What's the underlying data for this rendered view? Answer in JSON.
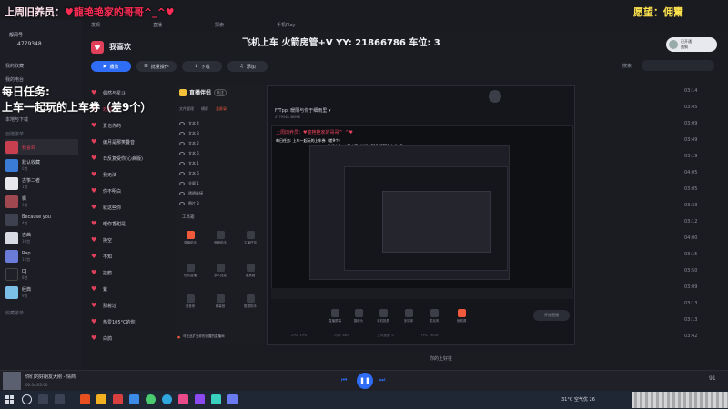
{
  "overlay": {
    "top_left_prefix": "上周旧养员：",
    "top_left_name": "♥龍艳艳家的哥哥^_^♥",
    "top_right": "愿望：佣鬻",
    "center_banner": "飞机上车 火箭房管+V YY: 21866786 车位: 3",
    "task_line1": "每日任务:",
    "task_line2": "上车一起玩的上车券（差9个）",
    "badge_id": "4779348",
    "badge_label": "靓阅号"
  },
  "music_app": {
    "nav": [
      "发现",
      "直播",
      "探索",
      "手机Play"
    ],
    "sidebar": {
      "items": [
        "我的收藏",
        "我的电台",
        "本地与下载"
      ],
      "section_created": "创建歌单",
      "section_collected": "收藏歌单",
      "playlists": [
        {
          "name": "我喜欢",
          "sub": "",
          "color": "#c84050"
        },
        {
          "name": "默认收藏",
          "sub": "0首",
          "color": "#3b7bd8"
        },
        {
          "name": "古筝二者",
          "sub": "1首",
          "color": "#e8e8ec"
        },
        {
          "name": "枫",
          "sub": "3首",
          "color": "#a0484f"
        },
        {
          "name": "Because you",
          "sub": "4首",
          "color": "#3e4150"
        },
        {
          "name": "古曲",
          "sub": "10首",
          "color": "#d8dbe4"
        },
        {
          "name": "Rap",
          "sub": "12首",
          "color": "#6a7bd8"
        },
        {
          "name": "DJ",
          "sub": "8首",
          "color": "#202028"
        },
        {
          "name": "经典",
          "sub": "9首",
          "color": "#7cc0e8"
        }
      ]
    },
    "library_title": "我喜欢",
    "buttons": {
      "play": "播放",
      "batch": "批量操作",
      "download": "下载",
      "add": "添加"
    },
    "sort_label": "搜索",
    "songs": [
      {
        "name": "偶然与星斗",
        "active": false
      },
      {
        "name": "戏腔",
        "active": true
      },
      {
        "name": "爱也你的",
        "active": false
      },
      {
        "name": "编月是那笑叠音",
        "active": false
      },
      {
        "name": "日反复受你(心病版)",
        "active": false
      },
      {
        "name": "我无法",
        "active": false
      },
      {
        "name": "你不明白",
        "active": false
      },
      {
        "name": "就这些你",
        "active": false
      },
      {
        "name": "眼你香甜是",
        "active": false
      },
      {
        "name": "换空",
        "active": false
      },
      {
        "name": "不知",
        "active": false
      },
      {
        "name": "拉鹤",
        "active": false
      },
      {
        "name": "紫",
        "active": false
      },
      {
        "name": "别着过",
        "active": false
      },
      {
        "name": "热爱105°C的你",
        "active": false
      },
      {
        "name": "白鸽",
        "active": false
      }
    ],
    "durations": [
      "03:14",
      "03:45",
      "03:09",
      "03:49",
      "03:19",
      "04:05",
      "03:05",
      "03:33",
      "03:12",
      "04:00",
      "03:15",
      "03:50",
      "03:09",
      "03:13",
      "03:13",
      "03:42"
    ],
    "user_box": {
      "name": "已开通",
      "sub": "曲钢"
    }
  },
  "stream_app": {
    "logo": "直播伴侣",
    "logo_badge": "关注",
    "tabs": [
      "文件管理",
      "横屏",
      "竖屏录"
    ],
    "sources": [
      "文本 4",
      "文本 3",
      "文本 2",
      "文本 5",
      "文本 1",
      "文本 6",
      "全屏 1",
      "透明连接",
      "图片 3"
    ],
    "tools_label": "工具箱",
    "tools": [
      "直播助手",
      "房管助手",
      "主播任务",
      "优质直播",
      "多人连麦",
      "道具箱",
      "语音房",
      "弹幕音",
      "数据助手"
    ],
    "notice": "可在此扩充你的设置的直播间",
    "title": "F/Tpp: 暖阳与你于细雨里 ▾",
    "stats": "4779348  46066",
    "preview_text_a": "上周旧养员：♥龍艳艳家的哥哥^_^♥",
    "preview_text_b": "每日任务: 上车一起玩的上车券（差9个）",
    "preview_text_c": "飞机上车 火箭房管+V YY: 21866786 车位: 3",
    "controls": [
      "直播屏幕",
      "摄像头",
      "手机投屏",
      "多媒体",
      "麦克风",
      "音频源"
    ],
    "go_live": "开始直播",
    "status": [
      "CPU: 19%",
      "内存: 88%",
      "上传速度: 0",
      "FPS: 26/26"
    ]
  },
  "player": {
    "title": "你们的好朋友大刚 - 情商",
    "time": "00:04/03:00",
    "lyric": "你的上好往",
    "volume": "91"
  },
  "taskbar": {
    "weather": "31°C 空气优 26",
    "colors": [
      "#3b8be8",
      "#d84040",
      "#f0b020",
      "#e85020",
      "#2fa8e0",
      "#4a8ef0",
      "#e84a8a",
      "#4acb70",
      "#8a4af0",
      "#f06a3a",
      "#3ad0c0",
      "#6a7af0"
    ]
  }
}
